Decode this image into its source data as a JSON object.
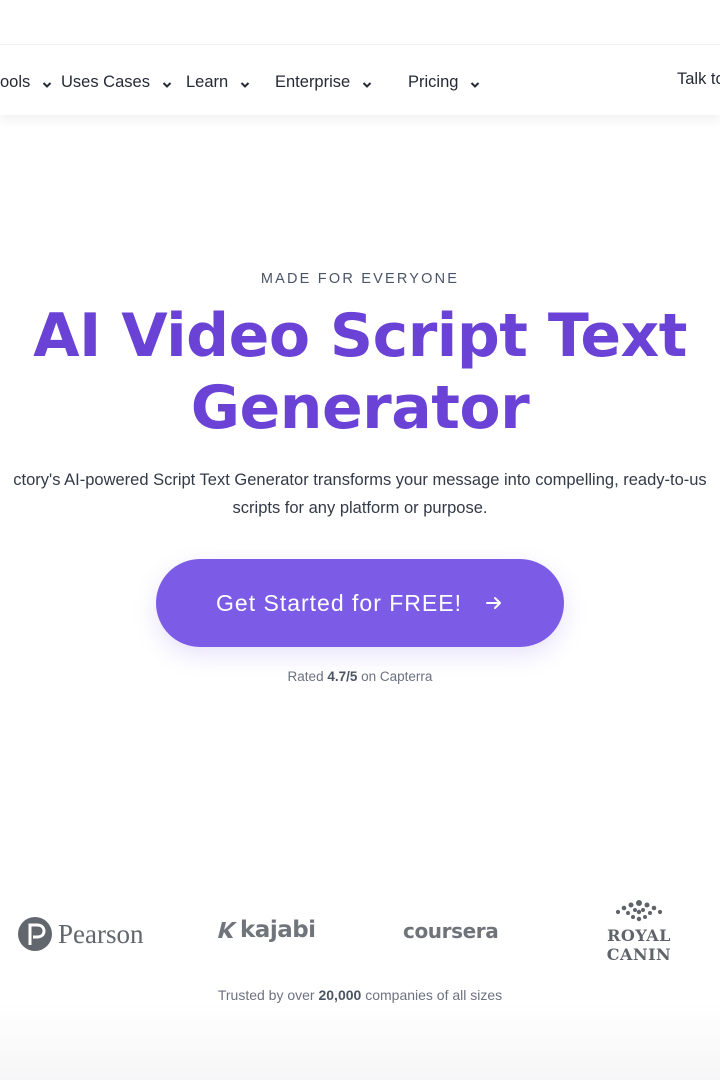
{
  "nav": {
    "items": [
      {
        "label": "ools"
      },
      {
        "label": "Uses Cases"
      },
      {
        "label": "Learn"
      },
      {
        "label": "Enterprise"
      },
      {
        "label": "Pricing"
      }
    ],
    "right_label": "Talk to"
  },
  "hero": {
    "eyebrow": "MADE FOR EVERYONE",
    "title": "AI Video Script Text Generator",
    "subtitle": "ctory's AI-powered Script Text Generator transforms your message into compelling, ready-to-us\nscripts for any platform or purpose.",
    "cta_label": "Get Started for FREE!",
    "cta_icon": "arrow-right-icon",
    "rating_prefix": "Rated",
    "rating_value": "4.7/5",
    "rating_suffix": "on Capterra"
  },
  "logos": {
    "pearson": "Pearson",
    "kajabi": "kajabi",
    "coursera": "coursera",
    "royal_canin": "ROYAL CANIN"
  },
  "trusted": {
    "prefix": "Trusted by over",
    "count": "20,000",
    "suffix": "companies of all sizes"
  },
  "colors": {
    "accent": "#7c5ce6",
    "title": "#6a43d6"
  }
}
